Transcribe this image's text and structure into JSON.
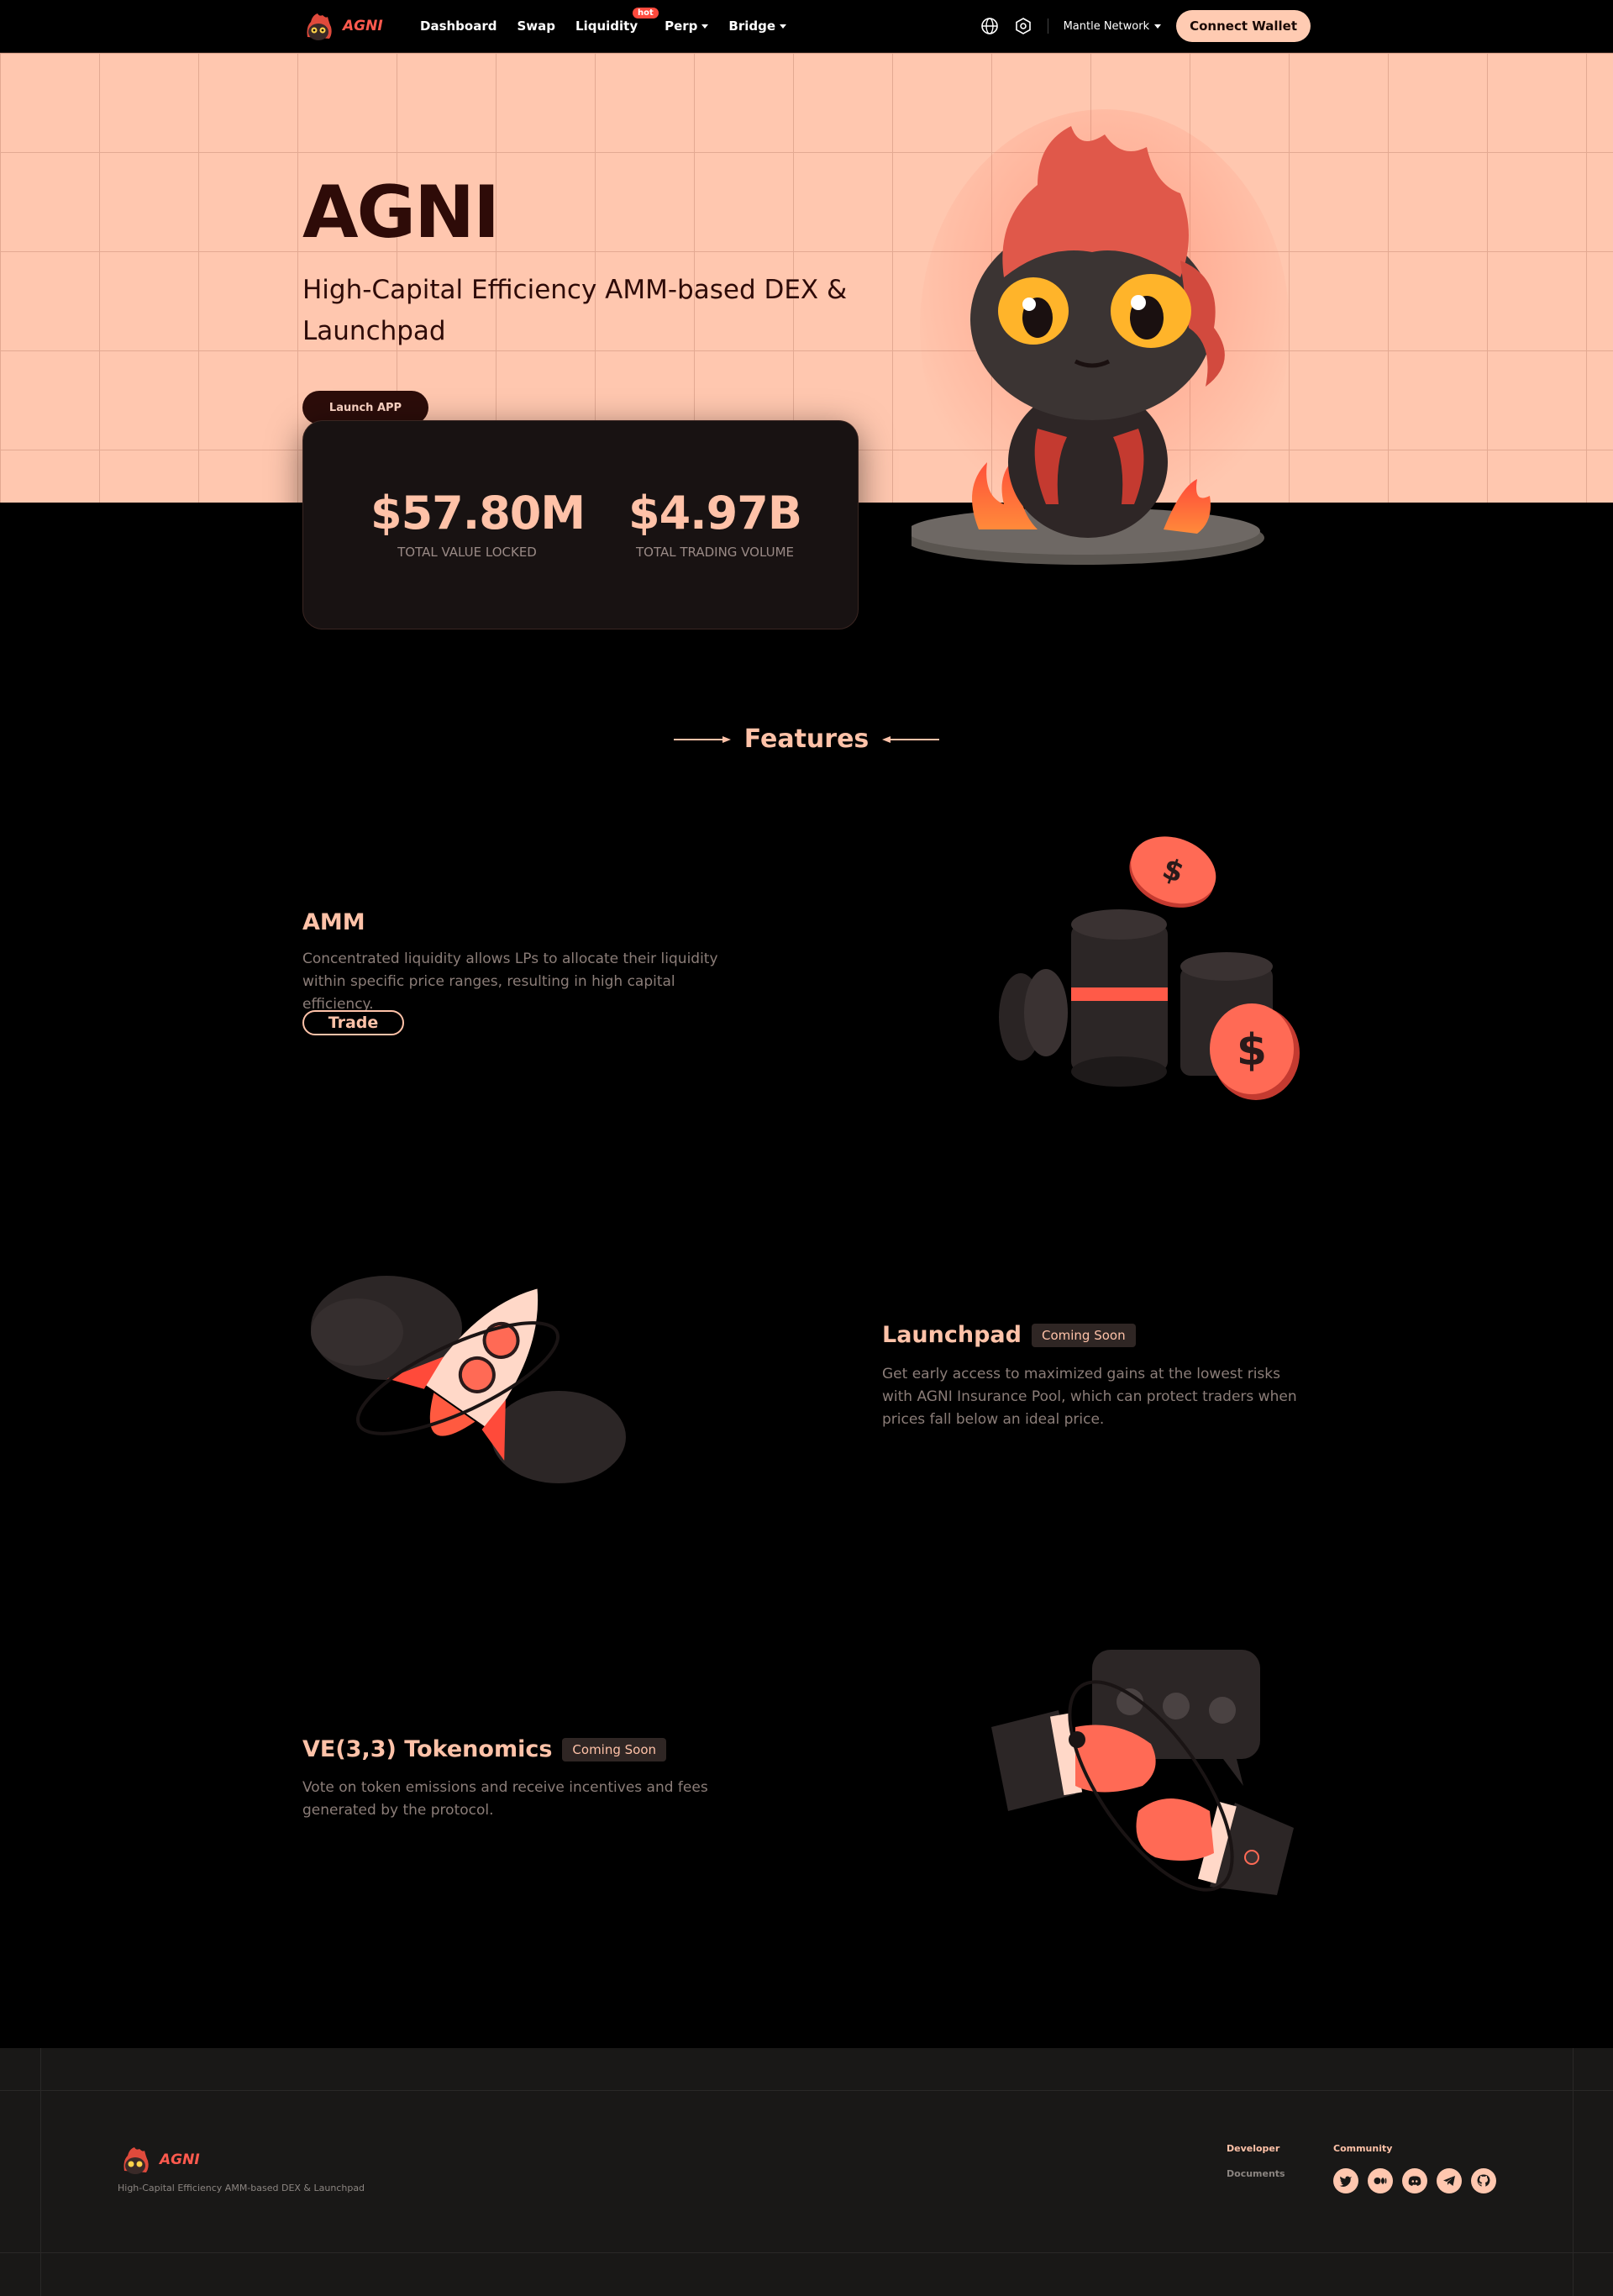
{
  "nav": {
    "logo_text": "AGNI",
    "links": [
      {
        "label": "Dashboard"
      },
      {
        "label": "Swap"
      },
      {
        "label": "Liquidity",
        "badge": "hot"
      },
      {
        "label": "Perp"
      },
      {
        "label": "Bridge"
      }
    ],
    "network": "Mantle Network",
    "connect": "Connect Wallet"
  },
  "hero": {
    "title": "AGNI",
    "subtitle": "High-Capital Efficiency AMM-based DEX & Launchpad",
    "cta": "Launch APP"
  },
  "stats": [
    {
      "value": "$57.80M",
      "label": "TOTAL VALUE LOCKED"
    },
    {
      "value": "$4.97B",
      "label": "TOTAL TRADING VOLUME"
    }
  ],
  "features": {
    "title": "Features",
    "items": [
      {
        "title": "AMM",
        "desc": "Concentrated liquidity allows LPs to allocate their liquidity within specific price ranges, resulting in high capital efficiency.",
        "button": "Trade"
      },
      {
        "title": "Launchpad",
        "badge": "Coming Soon",
        "desc": "Get early access to maximized gains at the lowest risks with AGNI Insurance Pool, which can protect traders when prices fall below an ideal price."
      },
      {
        "title": "VE(3,3) Tokenomics",
        "badge": "Coming Soon",
        "desc": "Vote on token emissions and receive incentives and fees generated by the protocol."
      }
    ]
  },
  "footer": {
    "logo_text": "AGNI",
    "tagline": "High-Capital Efficiency AMM-based DEX & Launchpad",
    "developer_title": "Developer",
    "developer_links": [
      "Documents"
    ],
    "community_title": "Community",
    "socials": [
      "twitter-icon",
      "medium-icon",
      "discord-icon",
      "telegram-icon",
      "github-icon"
    ]
  },
  "colors": {
    "accent": "#ffc2a8",
    "hero_bg": "#ffc7af",
    "brand_red": "#ff5a4e"
  }
}
